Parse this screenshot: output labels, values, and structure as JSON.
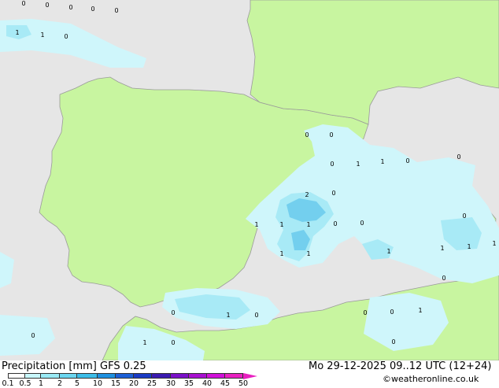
{
  "header": {
    "title": "Precipitation [mm] GFS 0.25",
    "datetime": "Mo 29-12-2025 09..12 UTC (12+24)",
    "credit": "©weatheronline.co.uk"
  },
  "colors": {
    "sea": "#e6e6e6",
    "land": "#c8f5a0",
    "border": "#9a9a9a",
    "precip_light": "#cff6fb",
    "precip_mid": "#a8eaf6",
    "precip_heavy": "#73cfee"
  },
  "legend": {
    "ticks": [
      "0.1",
      "0.5",
      "1",
      "2",
      "5",
      "10",
      "15",
      "20",
      "25",
      "30",
      "35",
      "40",
      "45",
      "50"
    ],
    "colors": [
      "#ffffff",
      "#c8f7fb",
      "#9aeaf5",
      "#6bd6f0",
      "#3cbde8",
      "#1e90e0",
      "#1c5fd6",
      "#1a3ac4",
      "#3a1ab0",
      "#7a10c8",
      "#a810d0",
      "#d010d8",
      "#e820c0"
    ]
  },
  "map_labels": [
    {
      "name": "label-0-a",
      "text": "0"
    },
    {
      "name": "label-0-b",
      "text": "0"
    },
    {
      "name": "label-0-c",
      "text": "0"
    },
    {
      "name": "label-0-d",
      "text": "0"
    },
    {
      "name": "label-0-e",
      "text": "0"
    },
    {
      "name": "label-1-a",
      "text": "1"
    },
    {
      "name": "label-1-b",
      "text": "1"
    },
    {
      "name": "label-0-f",
      "text": "0"
    },
    {
      "name": "label-0-g",
      "text": "0"
    },
    {
      "name": "label-0-h",
      "text": "0"
    },
    {
      "name": "label-0-i",
      "text": "0"
    },
    {
      "name": "label-1-c",
      "text": "1"
    },
    {
      "name": "label-1-d",
      "text": "1"
    },
    {
      "name": "label-0-j",
      "text": "0"
    },
    {
      "name": "label-0-k",
      "text": "0"
    },
    {
      "name": "label-2-a",
      "text": "2"
    },
    {
      "name": "label-0-l",
      "text": "0"
    },
    {
      "name": "label-0-m",
      "text": "0"
    },
    {
      "name": "label-1-e",
      "text": "1"
    },
    {
      "name": "label-1-f",
      "text": "1"
    },
    {
      "name": "label-1-g",
      "text": "1"
    },
    {
      "name": "label-0-n",
      "text": "0"
    },
    {
      "name": "label-0-o",
      "text": "0"
    },
    {
      "name": "label-1-h",
      "text": "1"
    },
    {
      "name": "label-1-i",
      "text": "1"
    },
    {
      "name": "label-1-j",
      "text": "1"
    },
    {
      "name": "label-1-k",
      "text": "1"
    },
    {
      "name": "label-1-l",
      "text": "1"
    },
    {
      "name": "label-1-m",
      "text": "1"
    },
    {
      "name": "label-0-p",
      "text": "0"
    },
    {
      "name": "label-0-q",
      "text": "0"
    },
    {
      "name": "label-1-n",
      "text": "1"
    },
    {
      "name": "label-0-r",
      "text": "0"
    },
    {
      "name": "label-0-s",
      "text": "0"
    },
    {
      "name": "label-0-t",
      "text": "0"
    },
    {
      "name": "label-1-o",
      "text": "1"
    },
    {
      "name": "label-0-u",
      "text": "0"
    },
    {
      "name": "label-1-p",
      "text": "1"
    },
    {
      "name": "label-0-v",
      "text": "0"
    },
    {
      "name": "label-0-w",
      "text": "0"
    }
  ]
}
